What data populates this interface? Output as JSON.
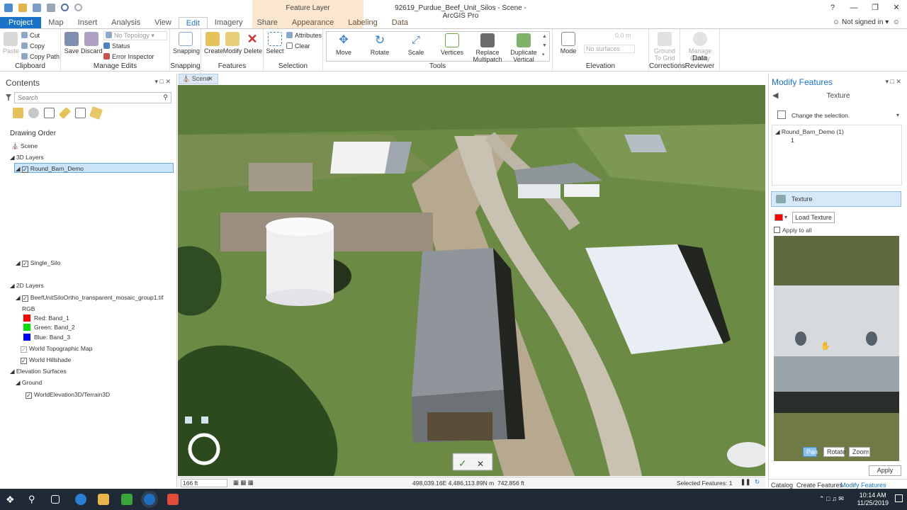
{
  "app": {
    "window_title": "92619_Purdue_Beef_Unit_Silos - Scene - ArcGIS Pro",
    "context_tab_title": "Feature Layer",
    "help": "?",
    "signin": "Not signed in"
  },
  "tabs": [
    "Project",
    "Map",
    "Insert",
    "Analysis",
    "View",
    "Edit",
    "Imagery",
    "Share",
    "Appearance",
    "Labeling",
    "Data"
  ],
  "ribbon": {
    "clipboard": {
      "label": "Clipboard",
      "paste": "Paste",
      "cut": "Cut",
      "copy": "Copy",
      "copy_path": "Copy Path"
    },
    "manage_edits": {
      "label": "Manage Edits",
      "save": "Save",
      "discard": "Discard",
      "topology": "No Topology",
      "status": "Status",
      "error_inspector": "Error Inspector"
    },
    "snapping": {
      "label": "Snapping",
      "button": "Snapping"
    },
    "features": {
      "label": "Features",
      "create": "Create",
      "modify": "Modify",
      "delete": "Delete"
    },
    "selection": {
      "label": "Selection",
      "select": "Select",
      "attributes": "Attributes",
      "clear": "Clear"
    },
    "tools": {
      "label": "Tools",
      "move": "Move",
      "rotate": "Rotate",
      "scale": "Scale",
      "vertices": "Vertices",
      "replace_multipatch": [
        "Replace",
        "Multipatch"
      ],
      "duplicate_vertical": [
        "Duplicate",
        "Vertical"
      ]
    },
    "elevation": {
      "label": "Elevation",
      "mode": "Mode",
      "surface": "No surfaces",
      "z_value": "0.0 m"
    },
    "corrections": {
      "label": "Corrections",
      "ground_to_grid": [
        "Ground",
        "To Grid"
      ]
    },
    "data_reviewer": {
      "label": "Data Reviewer",
      "manage_quality": [
        "Manage",
        "Quality"
      ]
    }
  },
  "contents": {
    "title": "Contents",
    "search_placeholder": "Search",
    "drawing_order": "Drawing Order",
    "scene": "Scene",
    "layers_3d": "3D Layers",
    "round_barn": "Round_Barn_Demo",
    "single_silo": "Single_Silo",
    "layers_2d": "2D Layers",
    "ortho": "BeefUnitSiloOrtho_transparent_mosaic_group1.tif",
    "rgb": "RGB",
    "bands": [
      {
        "label": "Red:  Band_1",
        "color": "#ff0000"
      },
      {
        "label": "Green: Band_2",
        "color": "#00e000"
      },
      {
        "label": "Blue:  Band_3",
        "color": "#0000ff"
      }
    ],
    "topo": "World Topographic Map",
    "hillshade": "World Hillshade",
    "elev_surfaces": "Elevation Surfaces",
    "ground": "Ground",
    "terrain": "WorldElevation3D/Terrain3D"
  },
  "view": {
    "tab": "Scene",
    "scale": "166 ft",
    "coords": "498,039.16E 4,486,113.89N m",
    "elevation": "742.856 ft",
    "selected": "Selected Features: 1"
  },
  "modify": {
    "title": "Modify Features",
    "tool": "Texture",
    "change_selection": "Change the selection.",
    "tree_layer": "Round_Barn_Demo  (1)",
    "tree_item": "1",
    "section": "Texture",
    "load_texture": "Load Texture",
    "apply_all": "Apply to all",
    "pan": "Pan",
    "rotate": "Rotate",
    "zoom": "Zoom",
    "apply": "Apply",
    "bottom_tabs": [
      "Catalog",
      "Create Features",
      "Modify Features"
    ]
  },
  "taskbar": {
    "time": "10:14 AM",
    "date": "11/25/2019"
  },
  "colors": {
    "accent": "#1a73c9",
    "context": "#fbe6cf",
    "selection": "#cce4f7",
    "taskbar": "#1f2a36"
  }
}
